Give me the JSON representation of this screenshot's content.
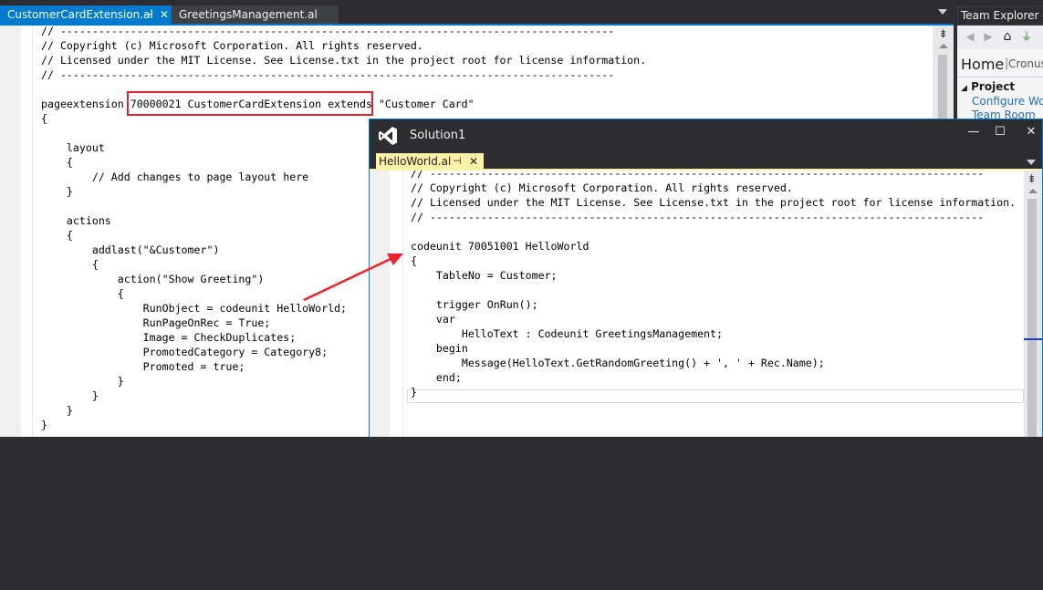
{
  "main_window": {
    "tabs": [
      {
        "label": "CustomerCardExtension.al",
        "pin_icon": "pin-icon",
        "close_icon": "close-icon"
      },
      {
        "label": "GreetingsManagement.al"
      }
    ],
    "editor_lines": [
      "// ---------------------------------------------------------------------------------------",
      "// Copyright (c) Microsoft Corporation. All rights reserved.",
      "// Licensed under the MIT License. See License.txt in the project root for license information.",
      "// ---------------------------------------------------------------------------------------",
      "",
      "pageextension 70000021 CustomerCardExtension extends \"Customer Card\"",
      "{",
      "",
      "    layout",
      "    {",
      "        // Add changes to page layout here",
      "    }",
      "",
      "    actions",
      "    {",
      "        addlast(\"&Customer\")",
      "        {",
      "            action(\"Show Greeting\")",
      "            {",
      "                RunObject = codeunit HelloWorld;",
      "                RunPageOnRec = True;",
      "                Image = CheckDuplicates;",
      "                PromotedCategory = Category8;",
      "                Promoted = true;",
      "            }",
      "        }",
      "    }",
      "}"
    ]
  },
  "team_explorer": {
    "title": "Team Explorer - H",
    "home_label": "Home",
    "separator": "|",
    "context": "Cronus",
    "section_title": "Project",
    "links": [
      "Configure Wor",
      "Team Room"
    ]
  },
  "solution_window": {
    "title": "Solution1",
    "controls": {
      "minimize": "—",
      "maximize": "☐",
      "close": "✕"
    },
    "tab_label": "HelloWorld.al",
    "editor_lines": [
      "// ---------------------------------------------------------------------------------------",
      "// Copyright (c) Microsoft Corporation. All rights reserved.",
      "// Licensed under the MIT License. See License.txt in the project root for license information.",
      "// ---------------------------------------------------------------------------------------",
      "",
      "codeunit 70051001 HelloWorld",
      "{",
      "    TableNo = Customer;",
      "",
      "    trigger OnRun();",
      "    var",
      "        HelloText : Codeunit GreetingsManagement;",
      "    begin",
      "        Message(HelloText.GetRandomGreeting() + ', ' + Rec.Name);",
      "    end;",
      "}"
    ]
  },
  "colors": {
    "accent": "#007acc",
    "annotation_red": "#e8232b",
    "active_float_tab": "#fff1a8"
  }
}
